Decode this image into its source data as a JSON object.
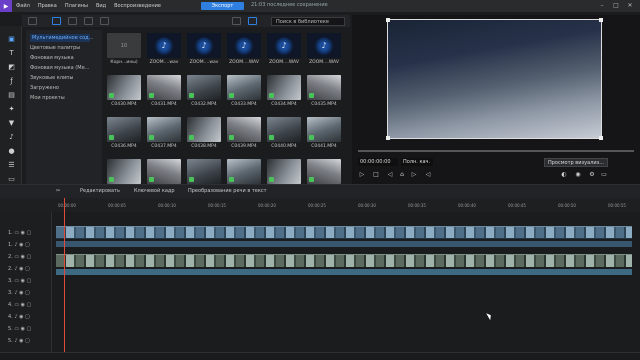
{
  "menubar": {
    "items": [
      "Файл",
      "Правка",
      "Плагины",
      "Вид",
      "Воспроизведение"
    ],
    "export_label": "Экспорт",
    "save_status": "21:03 последнее сохранение"
  },
  "library": {
    "search_placeholder": "Поиск в библиотеке",
    "side_items": [
      "Мультимедийное сод...",
      "Цветовые палитры",
      "Фоновая музыка",
      "Фоновая музыка (Ме...",
      "Звуковые клипы",
      "Загружено",
      "Мои проекты"
    ],
    "tiles": [
      {
        "label": "Корн...ины)",
        "kind": "folder"
      },
      {
        "label": "ZOOM....wav",
        "kind": "audio"
      },
      {
        "label": "ZOOM....wav",
        "kind": "audio"
      },
      {
        "label": "ZOOM....WAV",
        "kind": "audio"
      },
      {
        "label": "ZOOM....WAV",
        "kind": "audio"
      },
      {
        "label": "ZOOM....WAV",
        "kind": "audio"
      },
      {
        "label": "C0430.MP4",
        "kind": "vid"
      },
      {
        "label": "C0431.MP4",
        "kind": "vid"
      },
      {
        "label": "C0432.MP4",
        "kind": "vid"
      },
      {
        "label": "C0433.MP4",
        "kind": "vid"
      },
      {
        "label": "C0434.MP4",
        "kind": "vid"
      },
      {
        "label": "C0435.MP4",
        "kind": "vid"
      },
      {
        "label": "C0436.MP4",
        "kind": "vid"
      },
      {
        "label": "C0437.MP4",
        "kind": "vid"
      },
      {
        "label": "C0438.MP4",
        "kind": "vid"
      },
      {
        "label": "C0439.MP4",
        "kind": "vid"
      },
      {
        "label": "C0440.MP4",
        "kind": "vid"
      },
      {
        "label": "C0441.MP4",
        "kind": "vid"
      },
      {
        "label": "",
        "kind": "vid"
      },
      {
        "label": "",
        "kind": "vid"
      },
      {
        "label": "",
        "kind": "vid"
      },
      {
        "label": "",
        "kind": "vid"
      },
      {
        "label": "",
        "kind": "vid"
      },
      {
        "label": "",
        "kind": "vid"
      }
    ]
  },
  "preview": {
    "timecode": "00:00:00:00",
    "quality": "Полн. кач.",
    "viz_label": "Просмотр визуализ..."
  },
  "timeline": {
    "toolbar": {
      "edit": "Редактировать",
      "keyframe": "Ключевой кадр",
      "speech": "Преобразование речи в текст"
    },
    "ticks": [
      "00:00:00",
      "00:00:05",
      "00:00:10",
      "00:00:15",
      "00:00:20",
      "00:00:25",
      "00:00:30",
      "00:00:35",
      "00:00:40",
      "00:00:45",
      "00:00:50",
      "00:00:55"
    ],
    "tracks": [
      "1.",
      "1.",
      "2.",
      "2.",
      "3.",
      "3.",
      "4.",
      "4.",
      "5.",
      "5."
    ],
    "clip_label": "C0430"
  }
}
